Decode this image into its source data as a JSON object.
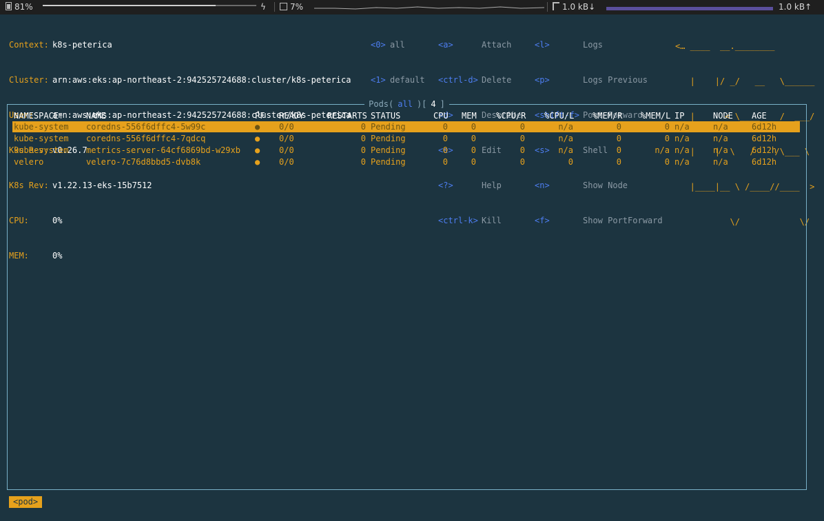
{
  "statusbar": {
    "battery": "81%",
    "cpu": "7%",
    "net_down": "1.0 kB↓",
    "net_up": "1.0 kB↑",
    "icons": [
      "battery-icon",
      "charging-icon",
      "cpu-icon",
      "network-icon"
    ]
  },
  "header": {
    "context_label": "Context:",
    "context": "k8s-peterica",
    "cluster_label": "Cluster:",
    "cluster": "arn:aws:eks:ap-northeast-2:942525724688:cluster/k8s-peterica",
    "user_label": "User:",
    "user": "arn:aws:eks:ap-northeast-2:942525724688:cluster/k8s-peterica",
    "k9s_rev_label": "K9s Rev:",
    "k9s_rev": "v0.26.7",
    "k8s_rev_label": "K8s Rev:",
    "k8s_rev": "v1.22.13-eks-15b7512",
    "cpu_label": "CPU:",
    "cpu": "0%",
    "mem_label": "MEM:",
    "mem": "0%"
  },
  "namespaces": [
    {
      "key": "<0>",
      "label": "all"
    },
    {
      "key": "<1>",
      "label": "default"
    }
  ],
  "commands_col1": [
    {
      "key": "<a>",
      "label": "Attach"
    },
    {
      "key": "<ctrl-d>",
      "label": "Delete"
    },
    {
      "key": "<d>",
      "label": "Describe"
    },
    {
      "key": "<e>",
      "label": "Edit"
    },
    {
      "key": "<?>",
      "label": "Help"
    },
    {
      "key": "<ctrl-k>",
      "label": "Kill"
    }
  ],
  "commands_col2": [
    {
      "key": "<l>",
      "label": "Logs"
    },
    {
      "key": "<p>",
      "label": "Logs Previous"
    },
    {
      "key": "<shift-f>",
      "label": "Port-Forward"
    },
    {
      "key": "<s>",
      "label": "Shell"
    },
    {
      "key": "<n>",
      "label": "Show Node"
    },
    {
      "key": "<f>",
      "label": "Show PortForward"
    }
  ],
  "logo_lines": [
    "<… ____  __.________",
    "   |    |/ _/   __   \\______",
    "   |      < \\____    /  ___/",
    "   |    |  \\   /    /\\___ \\",
    "   |____|__ \\ /____//____  >",
    "           \\/            \\/"
  ],
  "table": {
    "title_prefix": "Pods(",
    "title_filter": "all",
    "title_mid": ")[",
    "title_count": "4",
    "title_suffix": "]",
    "columns": [
      "NAMESPACE↑",
      "NAME",
      "PF",
      "READY",
      "RESTARTS",
      "STATUS",
      "CPU",
      "MEM",
      "%CPU/R",
      "%CPU/L",
      "%MEM/R",
      "%MEM/L",
      "IP",
      "NODE",
      "AGE"
    ],
    "rows": [
      {
        "namespace": "kube-system",
        "name": "coredns-556f6dffc4-5w99c",
        "pf": "●",
        "ready": "0/0",
        "restarts": "0",
        "status": "Pending",
        "cpu": "0",
        "mem": "0",
        "cpu_r": "0",
        "cpu_l": "n/a",
        "mem_r": "0",
        "mem_l": "0",
        "ip": "n/a",
        "node": "n/a",
        "age": "6d12h"
      },
      {
        "namespace": "kube-system",
        "name": "coredns-556f6dffc4-7qdcq",
        "pf": "●",
        "ready": "0/0",
        "restarts": "0",
        "status": "Pending",
        "cpu": "0",
        "mem": "0",
        "cpu_r": "0",
        "cpu_l": "n/a",
        "mem_r": "0",
        "mem_l": "0",
        "ip": "n/a",
        "node": "n/a",
        "age": "6d12h"
      },
      {
        "namespace": "kube-system",
        "name": "metrics-server-64cf6869bd-w29xb",
        "pf": "●",
        "ready": "0/0",
        "restarts": "0",
        "status": "Pending",
        "cpu": "0",
        "mem": "0",
        "cpu_r": "0",
        "cpu_l": "n/a",
        "mem_r": "0",
        "mem_l": "n/a",
        "ip": "n/a",
        "node": "n/a",
        "age": "6d12h"
      },
      {
        "namespace": "velero",
        "name": "velero-7c76d8bbd5-dvb8k",
        "pf": "●",
        "ready": "0/0",
        "restarts": "0",
        "status": "Pending",
        "cpu": "0",
        "mem": "0",
        "cpu_r": "0",
        "cpu_l": "0",
        "mem_r": "0",
        "mem_l": "0",
        "ip": "n/a",
        "node": "n/a",
        "age": "6d12h"
      }
    ]
  },
  "breadcrumb": "<pod>",
  "colors": {
    "background": "#1c3440",
    "accent": "#e6a11c",
    "key": "#4d7df0",
    "border": "#7ab2c9"
  }
}
